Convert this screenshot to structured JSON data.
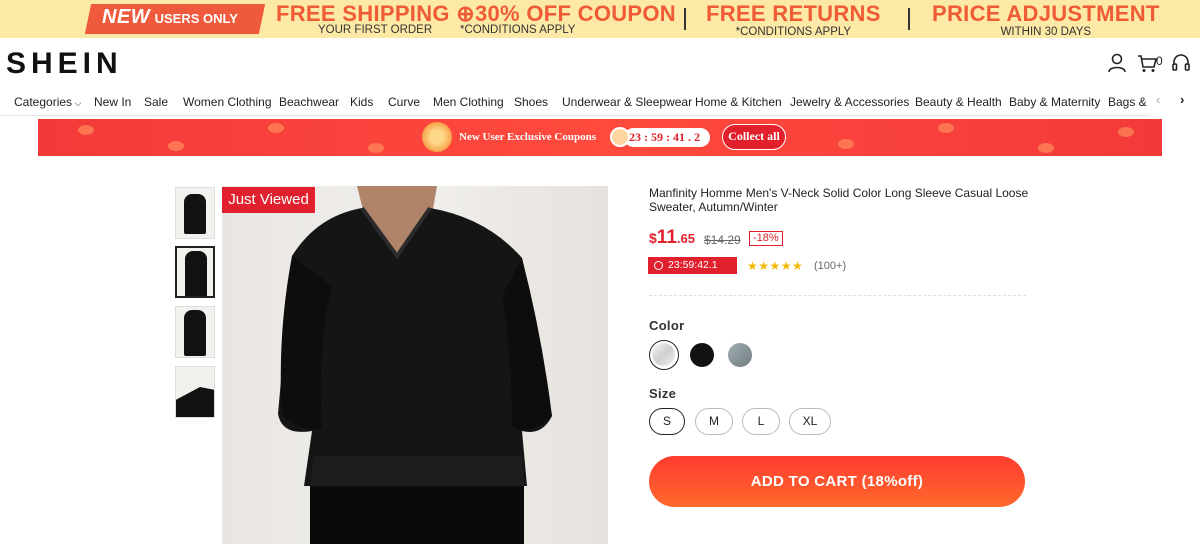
{
  "promo": {
    "new_big": "NEW",
    "new_small": "USERS ONLY",
    "shipping": "FREE SHIPPING",
    "coupon": "30% OFF COUPON",
    "first_order": "YOUR FIRST ORDER",
    "conditions1": "*CONDITIONS APPLY",
    "returns": "FREE RETURNS",
    "conditions2": "*CONDITIONS APPLY",
    "price_adj": "PRICE ADJUSTMENT",
    "within": "WITHIN 30 DAYS"
  },
  "header": {
    "logo": "SHEIN",
    "cart_count": "0",
    "icons": [
      "user-icon",
      "cart-icon",
      "headset-icon"
    ]
  },
  "nav": {
    "items": [
      "Categories",
      "New In",
      "Sale",
      "Women Clothing",
      "Beachwear",
      "Kids",
      "Curve",
      "Men Clothing",
      "Shoes",
      "Underwear & Sleepwear",
      "Home & Kitchen",
      "Jewelry & Accessories",
      "Beauty & Health",
      "Baby & Maternity",
      "Bags & L"
    ],
    "prev_arrow": "‹",
    "next_arrow": "›"
  },
  "coupon_banner": {
    "title": "New User Exclusive Coupons",
    "timer": "23 : 59 : 41 . 2",
    "collect": "Collect all"
  },
  "gallery": {
    "badge": "Just Viewed",
    "thumbnails": [
      "front",
      "full",
      "back",
      "detail"
    ],
    "active_thumb": 1
  },
  "product": {
    "title": "Manfinity Homme Men's V-Neck Solid Color Long Sleeve Casual Loose Sweater, Autumn/Winter",
    "price_currency": "$",
    "price_whole": "11",
    "price_cents": ".65",
    "old_price": "$14.29",
    "discount": "-18%",
    "flash_timer": "23:59:42.1",
    "rating": 4.5,
    "stars": "★★★★★",
    "reviews": "(100+)",
    "color_label": "Color",
    "colors": [
      {
        "name": "white",
        "hex": "#e8e8e8"
      },
      {
        "name": "black",
        "hex": "#111111"
      },
      {
        "name": "grey",
        "hex": "#8a9699"
      }
    ],
    "size_label": "Size",
    "sizes": [
      "S",
      "M",
      "L",
      "XL"
    ],
    "selected_size": "S",
    "add_to_cart": "ADD TO CART",
    "add_to_cart_note": "(18%off)"
  },
  "colors": {
    "accent": "#e0212d",
    "promo_bg": "#fde9a6",
    "promo_text": "#ef5b34"
  }
}
